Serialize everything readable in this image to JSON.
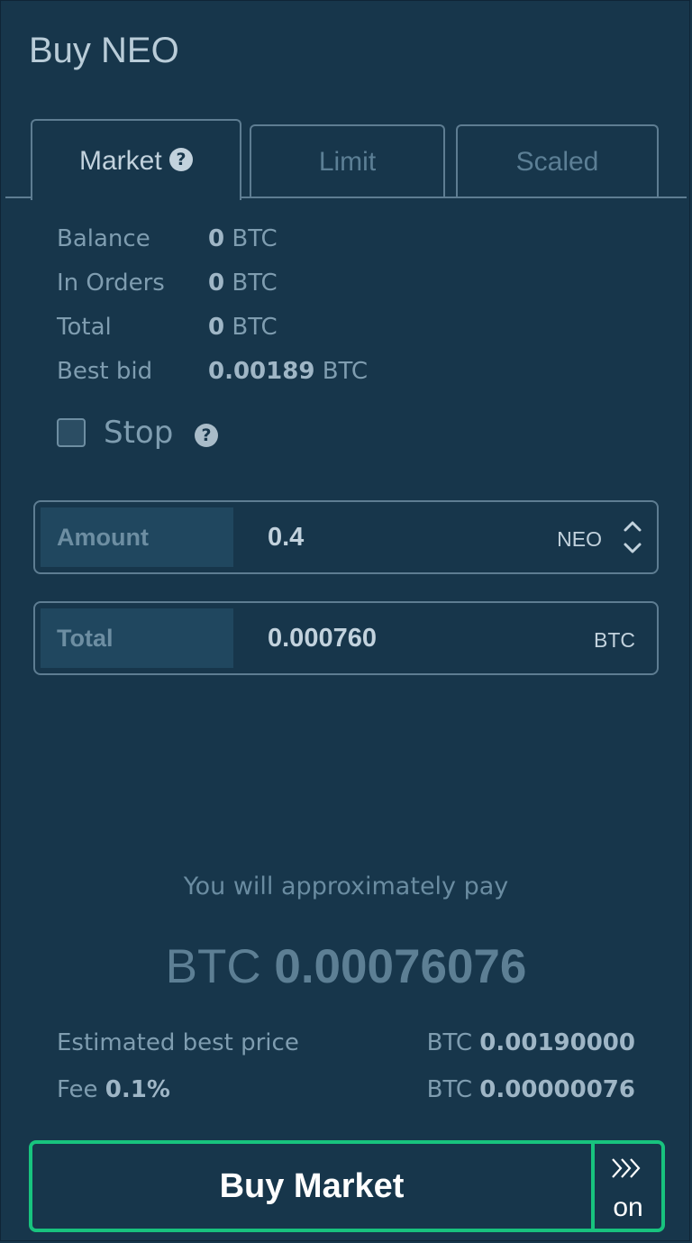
{
  "title": "Buy NEO",
  "tabs": [
    {
      "label": "Market",
      "active": true,
      "help": "?"
    },
    {
      "label": "Limit",
      "active": false
    },
    {
      "label": "Scaled",
      "active": false
    }
  ],
  "info": [
    {
      "label": "Balance",
      "value": "0",
      "unit": "BTC"
    },
    {
      "label": "In Orders",
      "value": "0",
      "unit": "BTC"
    },
    {
      "label": "Total",
      "value": "0",
      "unit": "BTC"
    },
    {
      "label": "Best bid",
      "value": "0.00189",
      "unit": "BTC"
    }
  ],
  "stop": {
    "label": "Stop",
    "checked": false,
    "help": "?"
  },
  "amount": {
    "label": "Amount",
    "value": "0.4",
    "unit": "NEO"
  },
  "total": {
    "label": "Total",
    "value": "0.000760",
    "unit": "BTC"
  },
  "summary": {
    "approx_text": "You will approximately pay",
    "currency": "BTC",
    "amount": "0.00076076",
    "best_price": {
      "label": "Estimated best price",
      "currency": "BTC",
      "value": "0.00190000"
    },
    "fee": {
      "label": "Fee",
      "pct": "0.1%",
      "currency": "BTC",
      "value": "0.00000076"
    }
  },
  "buy_button": {
    "label": "Buy Market",
    "toggle_label": "on"
  },
  "colors": {
    "background": "#17364b",
    "accent": "#18c37e",
    "border": "#5e7d92"
  },
  "icons": {
    "help": "question-circle-icon",
    "stepper": "chevron-up-down-icon",
    "toggle": "triple-chevron-right-icon"
  }
}
